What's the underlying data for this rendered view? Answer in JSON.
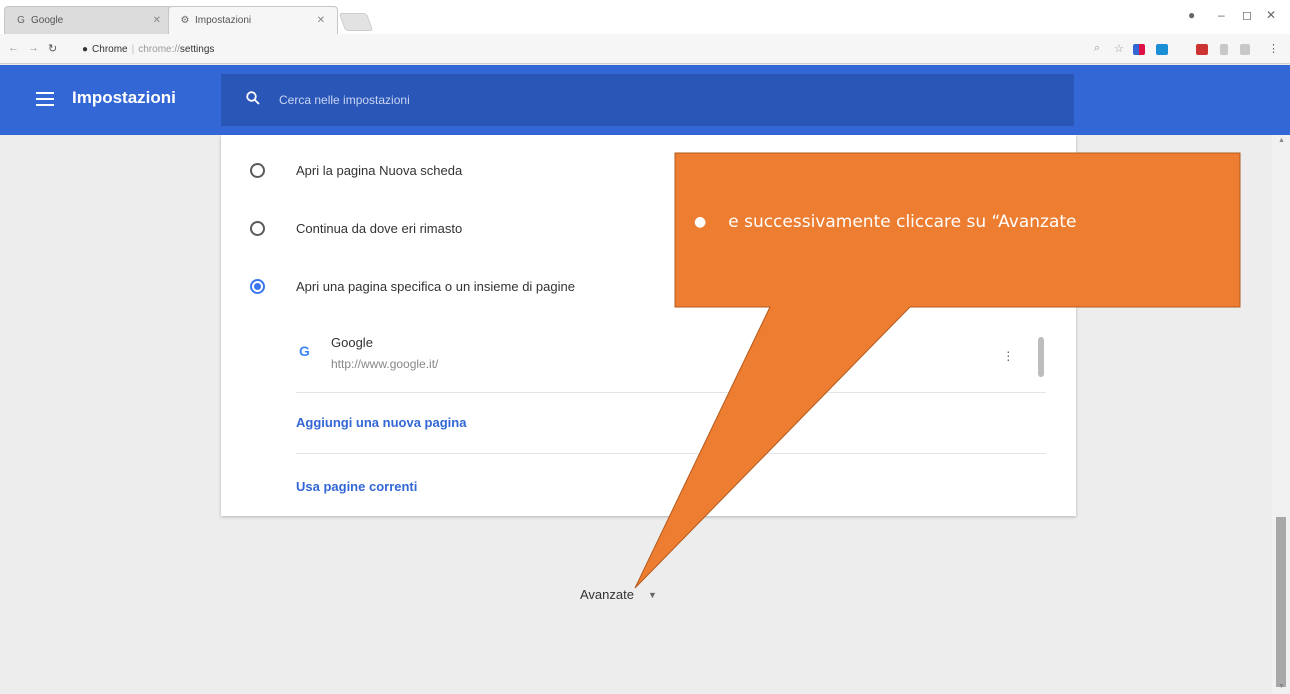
{
  "browser": {
    "tabs": [
      {
        "title": "Google",
        "active": false
      },
      {
        "title": "Impostazioni",
        "active": true
      }
    ],
    "omnibox": {
      "secure_label": "Chrome",
      "url_scheme": "chrome://",
      "url_path": "settings"
    },
    "window_controls": {
      "minimize": "–",
      "maximize": "◻",
      "close": "✕"
    }
  },
  "header": {
    "title": "Impostazioni",
    "search_placeholder": "Cerca nelle impostazioni",
    "color": "#3367d6"
  },
  "startup": {
    "options": [
      {
        "label": "Apri la pagina Nuova scheda",
        "checked": false
      },
      {
        "label": "Continua da dove eri rimasto",
        "checked": false
      },
      {
        "label": "Apri una pagina specifica o un insieme di pagine",
        "checked": true
      }
    ],
    "page": {
      "name": "Google",
      "url": "http://www.google.it/"
    },
    "add_page_label": "Aggiungi una nuova pagina",
    "use_current_label": "Usa pagine correnti"
  },
  "advanced": {
    "label": "Avanzate"
  },
  "callout": {
    "text": "e successivamente cliccare su “Avanzate",
    "color": "#ed7d31"
  }
}
